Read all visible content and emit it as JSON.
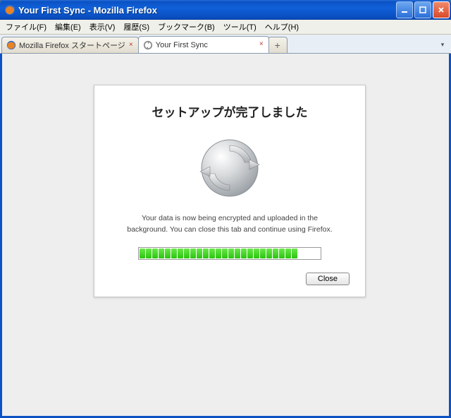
{
  "window": {
    "title": "Your First Sync - Mozilla Firefox"
  },
  "menu": {
    "file": "ファイル(F)",
    "edit": "編集(E)",
    "view": "表示(V)",
    "history": "履歴(S)",
    "bookmarks": "ブックマーク(B)",
    "tools": "ツール(T)",
    "help": "ヘルプ(H)"
  },
  "tabs": {
    "tab1": "Mozilla Firefox スタートページ",
    "tab2": "Your First Sync",
    "newtab_symbol": "+"
  },
  "panel": {
    "heading": "セットアップが完了しました",
    "line1": "Your data is now being encrypted and uploaded in the",
    "line2": "background. You can close this tab and continue using Firefox.",
    "close_label": "Close",
    "progress_segments": 25
  }
}
